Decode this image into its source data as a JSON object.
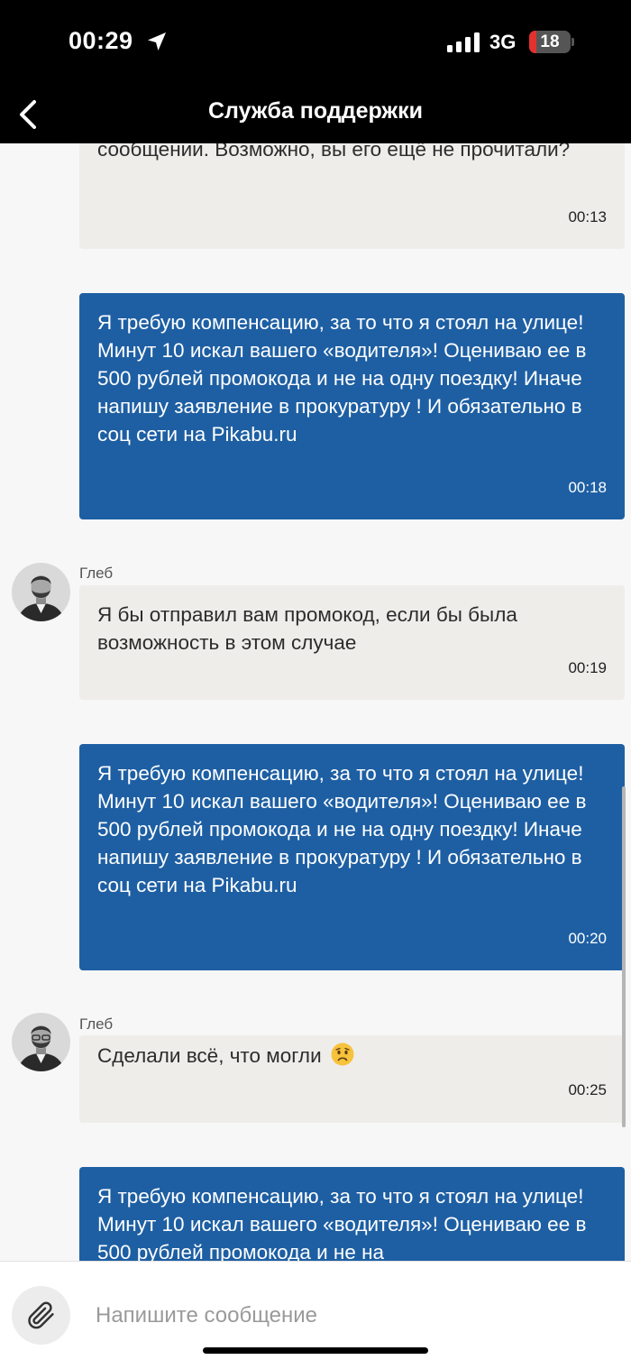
{
  "status_bar": {
    "time": "00:29",
    "network": "3G",
    "battery": "18",
    "battery_level_percent": 18,
    "location_icon": "location-arrow-icon",
    "signal_icon": "signal-bars-icon"
  },
  "nav": {
    "back_icon": "chevron-left-icon",
    "title": "Служба поддержки"
  },
  "messages": [
    {
      "direction": "incoming",
      "text": "сообщении. Возможно, вы его ещё не прочитали?",
      "time": "00:13"
    },
    {
      "direction": "outgoing",
      "text": "Я требую компенсацию, за то что я стоял на улице! Минут 10 искал вашего «водителя»! Оцениваю ее в 500 рублей промокода и не на одну поездку! Иначе напишу заявление в прокуратуру ! И обязательно в соц сети на Pikabu.ru",
      "time": "00:18"
    },
    {
      "direction": "incoming",
      "sender": "Глеб",
      "text": "Я бы отправил вам промокод, если бы была возможность в этом случае",
      "time": "00:19"
    },
    {
      "direction": "outgoing",
      "text": "Я требую компенсацию, за то что я стоял на улице! Минут 10 искал вашего «водителя»! Оцениваю ее в 500 рублей промокода и не на одну поездку! Иначе напишу заявление в прокуратуру ! И обязательно в соц сети на Pikabu.ru",
      "time": "00:20"
    },
    {
      "direction": "incoming",
      "sender": "Глеб",
      "text": "Сделали всё, что могли",
      "emoji": "worried-face-emoji",
      "time": "00:25"
    },
    {
      "direction": "outgoing",
      "text": "Я требую компенсацию, за то что я стоял на улице! Минут 10 искал вашего «водителя»! Оцениваю ее в 500 рублей промокода и не на",
      "time": ""
    }
  ],
  "composer": {
    "attach_icon": "paperclip-icon",
    "placeholder": "Напишите сообщение",
    "value": ""
  },
  "colors": {
    "outgoing_bubble": "#1e5fa3",
    "incoming_bubble": "#eeedea",
    "chat_background": "#f7f7f7",
    "header_background": "#000000",
    "battery_low": "#e53030"
  }
}
